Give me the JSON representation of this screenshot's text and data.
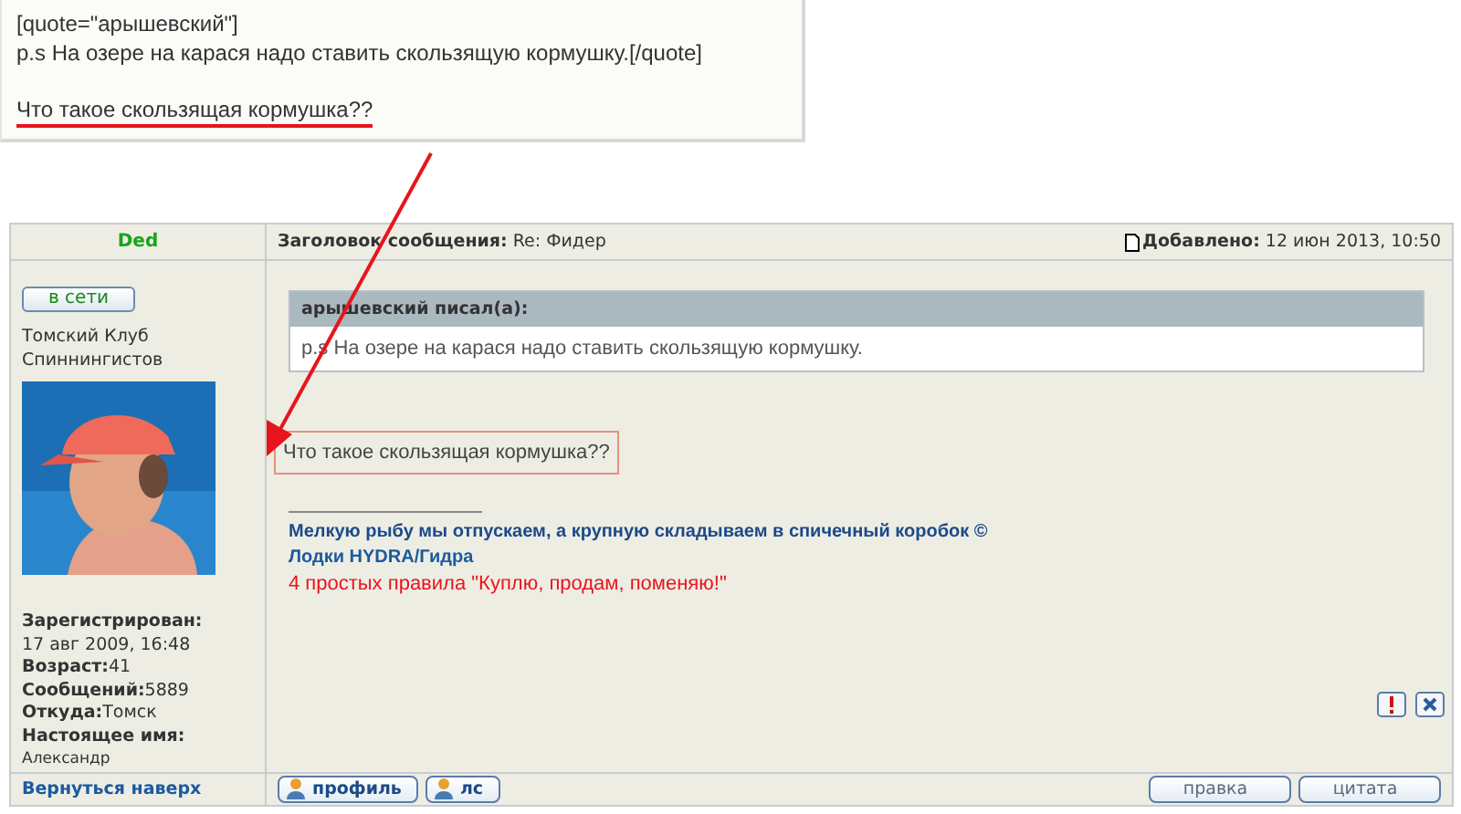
{
  "editor": {
    "lines": [
      {
        "text": "[quote=\"арышевский\"]",
        "kind": "plain"
      },
      {
        "text": "p.s На озере на карася надо ставить скользящую кормушку.[/quote]",
        "kind": "plain"
      },
      {
        "text": "Что такое скользящая кормушка??",
        "kind": "underlined"
      }
    ]
  },
  "post": {
    "author": "Ded",
    "status_button": "в сети",
    "rank": "Томский Клуб Спиннингистов",
    "profile": [
      {
        "label": "Зарегистрирован:",
        "value": "17 авг 2009, 16:48",
        "kind": "stacked"
      },
      {
        "label": "Возраст:",
        "value": "41",
        "kind": "inline"
      },
      {
        "label": "Сообщений:",
        "value": "5889",
        "kind": "inline"
      },
      {
        "label": "Откуда:",
        "value": "Томск",
        "kind": "inline"
      },
      {
        "label": "Настоящее имя:",
        "value": "Александр",
        "kind": "stacked"
      }
    ],
    "subject_label": "Заголовок сообщения:",
    "subject": "Re: Фидер",
    "added_label": "Добавлено:",
    "added": "12 июн 2013, 10:50",
    "quote": {
      "author": "арышевский писал(а):",
      "text": "p.s На озере на карася надо ставить скользящую кормушку."
    },
    "message": "Что такое скользящая кормушка??",
    "signature": [
      {
        "text": "Мелкую рыбу мы отпускаем, а крупную складываем в спичечный коробок ©",
        "kind": "bold-link"
      },
      {
        "text": "Лодки HYDRA/Гидра",
        "kind": "link"
      },
      {
        "text": "4 простых правила \"Куплю, продам, поменяю!\"",
        "kind": "red"
      }
    ],
    "back_link": "Вернуться наверх",
    "left_buttons": [
      "профиль",
      "лс"
    ],
    "right_buttons": [
      "правка",
      "цитата"
    ]
  }
}
